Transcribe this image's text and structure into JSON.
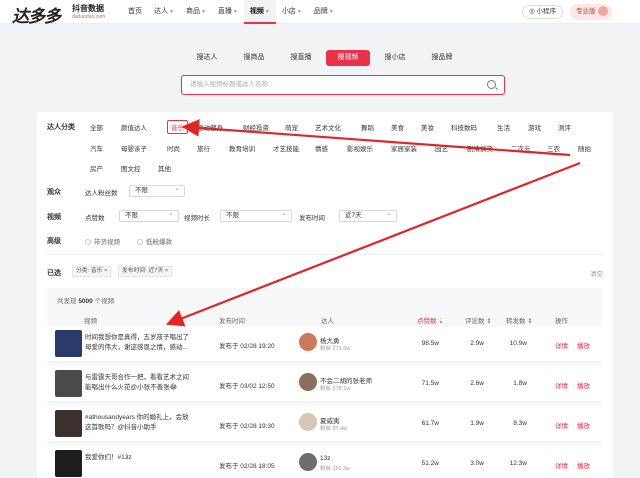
{
  "header": {
    "logo": "达多多",
    "logo_sub": "抖音数据",
    "logo_domain": "daduoduo.com",
    "nav": [
      {
        "label": "首页",
        "caret": false
      },
      {
        "label": "达人",
        "caret": true
      },
      {
        "label": "商品",
        "caret": true
      },
      {
        "label": "直播",
        "caret": true
      },
      {
        "label": "视频",
        "caret": true,
        "active": true
      },
      {
        "label": "小店",
        "caret": true
      },
      {
        "label": "品牌",
        "caret": true
      }
    ],
    "mini_program": "◎ 小程序",
    "pro_label": "专业版"
  },
  "search": {
    "tabs": [
      "搜达人",
      "搜商品",
      "搜直播",
      "搜视频",
      "搜小店",
      "搜品牌"
    ],
    "active_tab": "搜视频",
    "placeholder": "请输入视频标题或达人名称"
  },
  "filters": {
    "category_label": "达人分类",
    "categories_row1": [
      "全部",
      "颜值达人",
      "音乐",
      "运动健身",
      "财经投资",
      "萌宠",
      "艺术文化",
      "舞蹈",
      "美食",
      "美妆",
      "科技数码",
      "生活",
      "游戏",
      "测评"
    ],
    "categories_row2": [
      "汽车",
      "母婴亲子",
      "时尚",
      "旅行",
      "教育培训",
      "才艺技能",
      "情感",
      "影视娱乐",
      "家居家装",
      "园艺",
      "剧情搞笑",
      "二次元",
      "三农",
      "随拍"
    ],
    "categories_row3": [
      "房产",
      "图文控",
      "其他"
    ],
    "selected_category": "音乐",
    "audience_label": "观众",
    "audience_fans_label": "达人粉丝数",
    "audience_fans_value": "不限",
    "video_label": "视频",
    "likes_label": "点赞数",
    "likes_value": "不限",
    "duration_label": "视频时长",
    "duration_value": "不限",
    "publish_label": "发布时间",
    "publish_value": "近7天",
    "advanced_label": "高级",
    "radio1": "带货视频",
    "radio2": "低粉爆款",
    "selected_label": "已选",
    "chip1": "分类: 音乐 ×",
    "chip2": "发布时间: 近7天 ×",
    "clear": "清空"
  },
  "table": {
    "found_prefix": "共发现",
    "found_count": "5000",
    "found_suffix": "个视频",
    "headers": {
      "video": "视频",
      "publish": "发布时间",
      "author": "达人",
      "likes": "点赞数 ⇣",
      "comments": "评论数 ⇕",
      "shares": "转发数 ⇕",
      "action": "操作"
    },
    "rows": [
      {
        "title": "时间我想你是真得，五岁孩子唱出了母爱的伟大，谢这感恩之情，感动...",
        "publish": "发布于 02/28 19:20",
        "author": "杨大勇",
        "fans": "粉丝 271.6w",
        "likes": "98.5w",
        "comments": "2.9w",
        "shares": "10.9w",
        "detail": "详情",
        "play": "播放",
        "thumb": "#2b3a6b",
        "avatar": "#c97a5a"
      },
      {
        "title": "与雷霆天哥合作一把，看看艺术之间能唱出什么火花@小张不善张😂",
        "publish": "发布于 03/02 12:50",
        "author": "不会二胡的张老师",
        "fans": "粉丝 578.1w",
        "likes": "71.5w",
        "comments": "2.6w",
        "shares": "1.8w",
        "detail": "详情",
        "play": "播放",
        "thumb": "#4a4a4a",
        "avatar": "#8a6f5c"
      },
      {
        "title": "#athousandyears 你的婚礼上，会放这首歌吗？@抖音小助手",
        "publish": "发布于 02/28 19:30",
        "author": "夏威夷",
        "fans": "粉丝 97.4w",
        "likes": "61.7w",
        "comments": "1.9w",
        "shares": "8.3w",
        "detail": "详情",
        "play": "播放",
        "thumb": "#3b3030",
        "avatar": "#d8c6b8"
      },
      {
        "title": "我爱你们！#13z",
        "publish": "发布于 02/28 18:05",
        "author": "13z",
        "fans": "粉丝 116.3w",
        "likes": "51.2w",
        "comments": "3.0w",
        "shares": "12.3w",
        "detail": "详情",
        "play": "播放",
        "thumb": "#1e1e1e",
        "avatar": "#6d6d6d"
      }
    ]
  }
}
